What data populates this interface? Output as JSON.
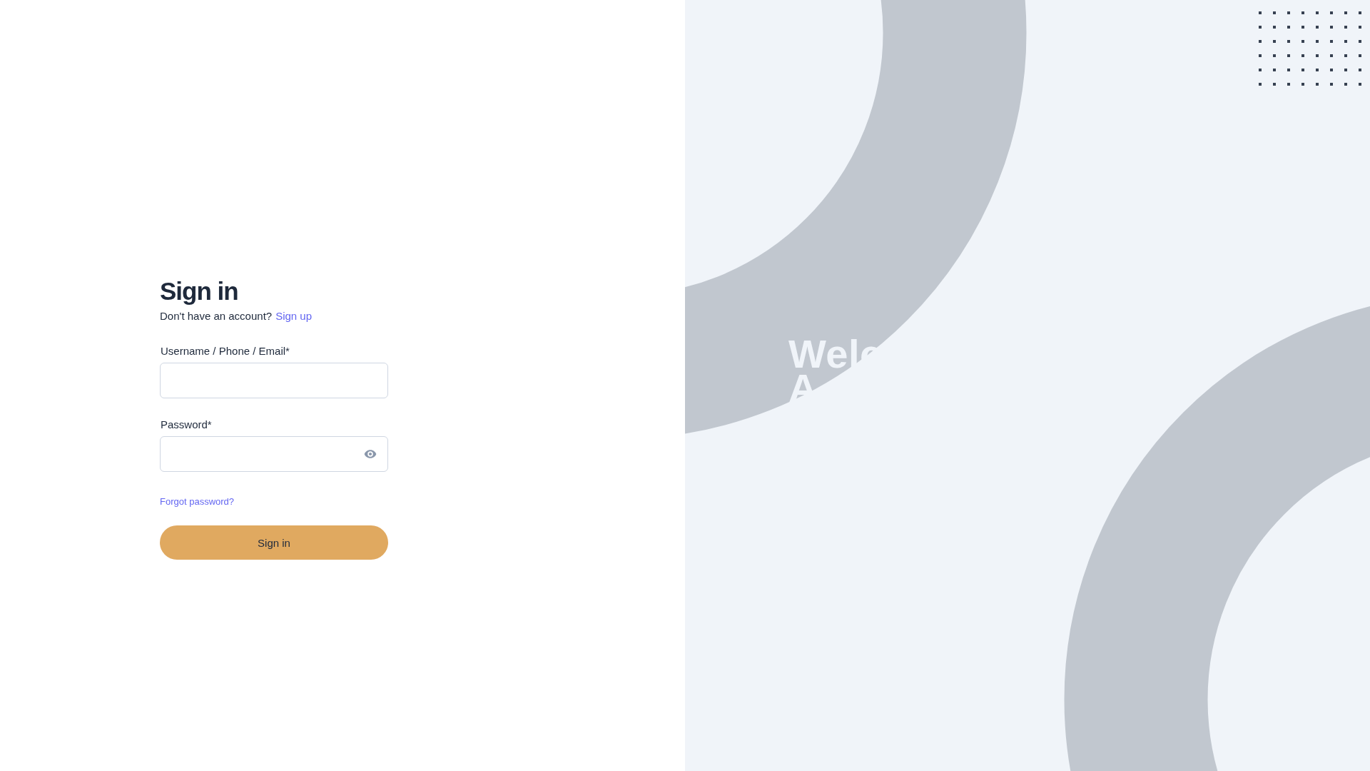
{
  "signin": {
    "title": "Sign in",
    "prompt": "Don't have an account?",
    "signup_link": "Sign up",
    "fields": [
      {
        "label": "Username / Phone / Email*",
        "kind": "text"
      },
      {
        "label": "Password*",
        "kind": "password"
      }
    ],
    "forgot_link": "Forgot password?",
    "button": "Sign in"
  },
  "hero": {
    "lines": [
      "Welc",
      "A"
    ]
  }
}
